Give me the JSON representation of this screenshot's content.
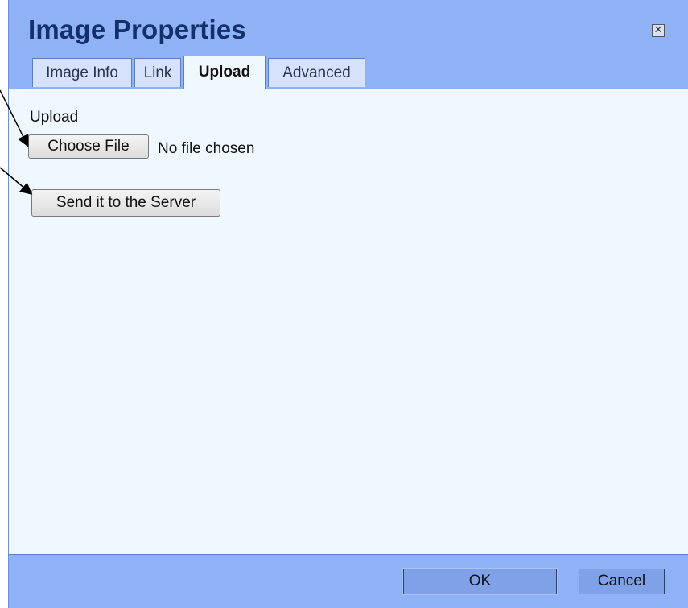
{
  "dialog": {
    "title": "Image Properties",
    "close_icon": "close-box-icon"
  },
  "tabs": [
    {
      "label": "Image Info",
      "active": false
    },
    {
      "label": "Link",
      "active": false
    },
    {
      "label": "Upload",
      "active": true
    },
    {
      "label": "Advanced",
      "active": false
    }
  ],
  "upload": {
    "label": "Upload",
    "choose_button": "Choose File",
    "file_status": "No file chosen",
    "send_button": "Send it to the Server"
  },
  "footer": {
    "ok_label": "OK",
    "cancel_label": "Cancel"
  },
  "colors": {
    "dialog_background": "#8fb2f7",
    "title_color": "#13306a",
    "panel_background": "#f0f8ff",
    "tab_background": "#d6e2fb"
  }
}
